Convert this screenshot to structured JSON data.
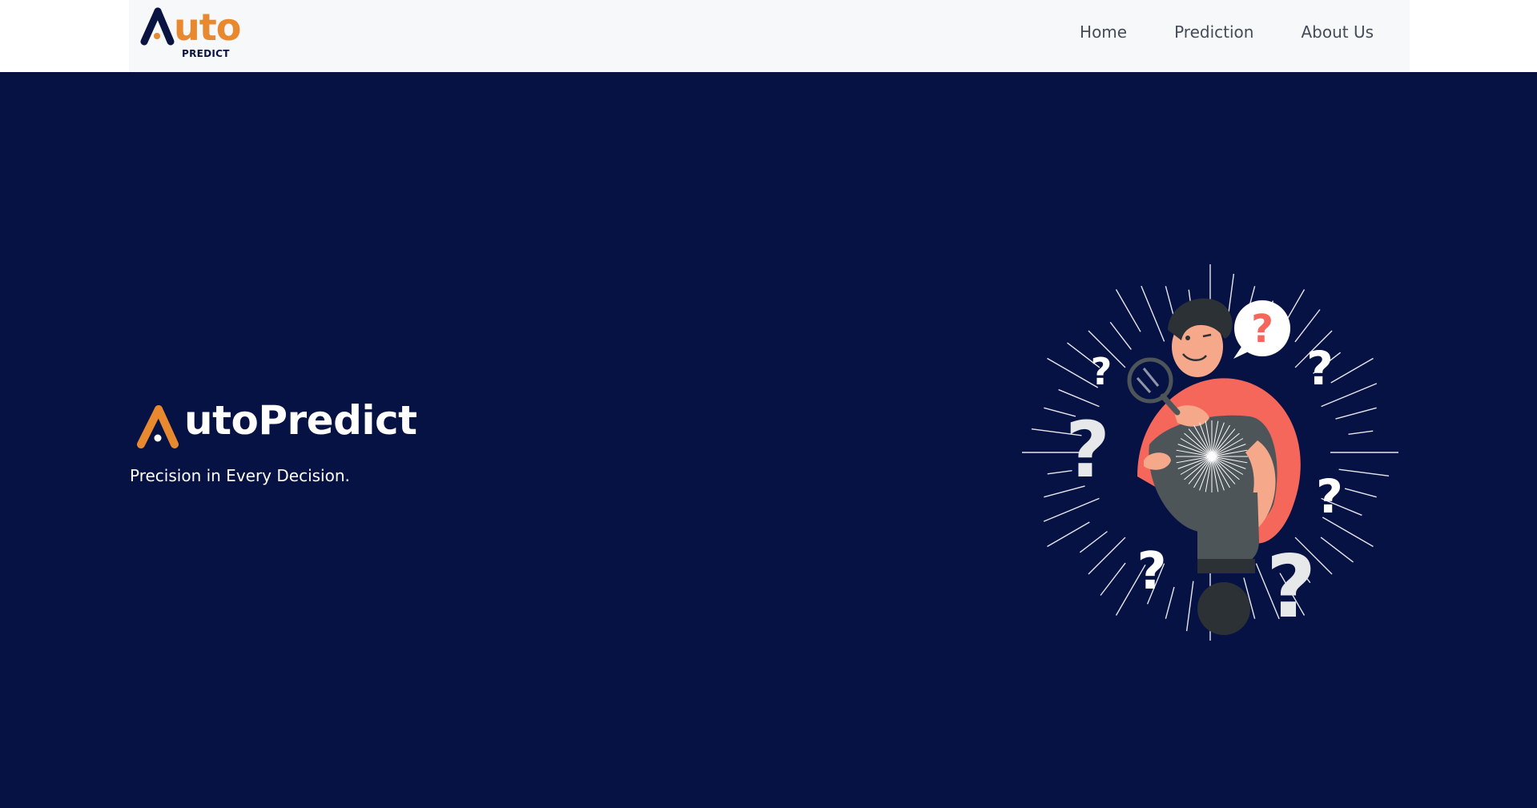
{
  "brand": {
    "word": "uto",
    "sub": "PREDICT"
  },
  "nav": {
    "items": [
      "Home",
      "Prediction",
      "About Us"
    ]
  },
  "hero": {
    "title": "utoPredict",
    "tagline": "Precision in Every Decision."
  },
  "colors": {
    "background": "#071244",
    "accent": "#e8892f",
    "navbar": "#f7f8fa"
  }
}
